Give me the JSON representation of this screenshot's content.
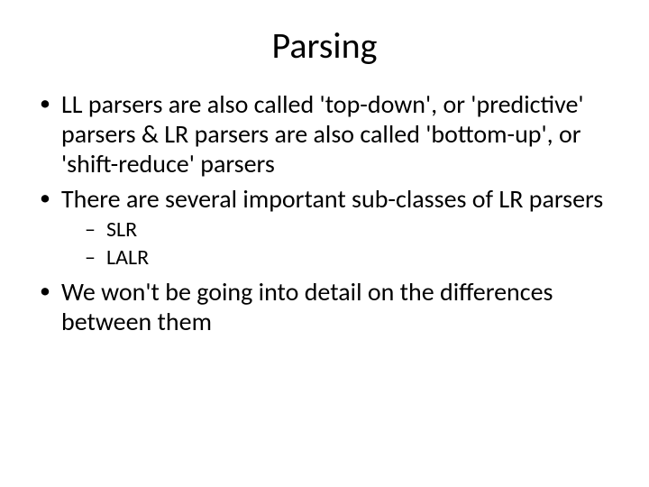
{
  "slide": {
    "title": "Parsing",
    "bullets": [
      "LL parsers are also called 'top-down', or 'predictive' parsers & LR parsers are also called 'bottom-up', or 'shift-reduce' parsers",
      "There are several important sub-classes of LR parsers",
      "We won't be going into detail on the differences between them"
    ],
    "subbullets": [
      "SLR",
      "LALR"
    ]
  }
}
